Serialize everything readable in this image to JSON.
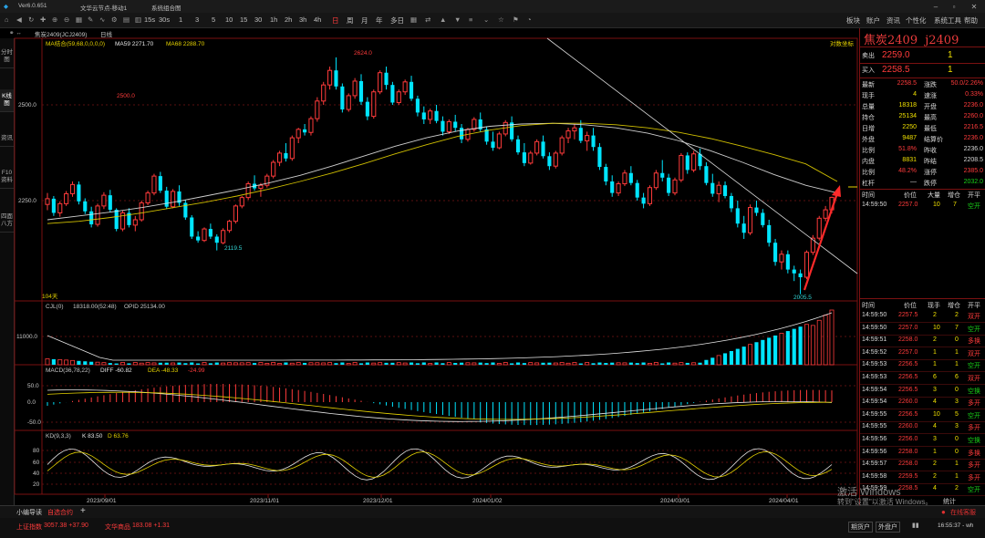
{
  "titlebar": {
    "app": "Ver6.0.651",
    "tabs": [
      "文华云节点-移动1",
      "系统组合图"
    ]
  },
  "toolbar": {
    "periods": [
      "1",
      "3",
      "5",
      "10",
      "15",
      "30",
      "1h",
      "2h",
      "3h",
      "4h",
      "日",
      "周",
      "月",
      "年",
      "多日"
    ],
    "right": [
      "板块",
      "账户",
      "资讯",
      "个性化",
      "系统工具",
      "帮助"
    ],
    "icon_names": [
      "home-icon",
      "back-icon",
      "refresh-icon",
      "cross-icon",
      "zoom-in-icon",
      "zoom-out-icon",
      "chart-icon",
      "draw-icon",
      "indicator-icon",
      "settings-icon",
      "layout-icon",
      "chevron-down-icon"
    ]
  },
  "subbar": {
    "contract": "焦炭2409(JCJ2409)",
    "period": "日线"
  },
  "left_tabs": [
    "分时图",
    "K线图",
    "资讯",
    "F10资料",
    "四面八方"
  ],
  "main": {
    "ma_line": "MA结合(59,68,0,0,0,0)",
    "ma59": "MA59 2271.70",
    "ma68": "MA68 2288.70",
    "log_label": "对数坐标",
    "y_labels": [
      "2500.0",
      "2250.0"
    ],
    "annotations": {
      "high": "2624.0",
      "mid": "2500.0",
      "low1": "2119.5",
      "low2": "2005.5",
      "days": "104天"
    }
  },
  "vol": {
    "label": "CJL(0)",
    "value": "18318.00(52:48)",
    "opi": "OPID 25134.00",
    "y_label": "11000.0"
  },
  "macd": {
    "label": "MACD(36,78,22)",
    "diff": "DIFF -60.82",
    "dea": "DEA -48.33",
    "val": "-24.99",
    "y_labels": [
      "50.0",
      "0.0",
      "-50.0"
    ]
  },
  "kd": {
    "label": "KD(9,3,3)",
    "k": "K 83.50",
    "d": "D 63.76",
    "y_labels": [
      "80",
      "60",
      "40",
      "20"
    ]
  },
  "x_labels": [
    "2023/09/01",
    "2023/11/01",
    "2023/12/01",
    "2024/01/02",
    "2024/03/01",
    "2024/04/01"
  ],
  "quote": {
    "name": "焦炭2409",
    "code": "j2409",
    "sell_label": "卖出",
    "sell_price": "2259.0",
    "sell_qty": "1",
    "buy_label": "买入",
    "buy_price": "2258.5",
    "buy_qty": "1",
    "rows": [
      [
        "最新",
        "2258.5",
        "涨跌",
        "50.0/2.26%"
      ],
      [
        "现手",
        "4",
        "速涨",
        "0.33%"
      ],
      [
        "总量",
        "18318",
        "开盘",
        "2236.0"
      ],
      [
        "持仓",
        "25134",
        "最高",
        "2260.0"
      ],
      [
        "日增",
        "2250",
        "最低",
        "2216.5"
      ],
      [
        "外盘",
        "9487",
        "结算价",
        "2236.0"
      ],
      [
        "比例",
        "51.8%",
        "昨收",
        "2236.0"
      ],
      [
        "内盘",
        "8831",
        "昨结",
        "2208.5"
      ],
      [
        "比例",
        "48.2%",
        "涨停",
        "2385.0"
      ],
      [
        "杠杆",
        "—",
        "跌停",
        "2032.0"
      ]
    ],
    "tick_header": [
      "时间",
      "价位",
      "现手",
      "增仓",
      "开平"
    ],
    "tick_header_top": [
      "时间",
      "价位",
      "大量",
      "增仓",
      "开平"
    ],
    "top_tick": [
      "14:59:50",
      "2257.0",
      "10",
      "7",
      "空开"
    ],
    "ticks": [
      [
        "14:59:50",
        "2257.5",
        "2",
        "2",
        "双开"
      ],
      [
        "14:59:50",
        "2257.0",
        "10",
        "7",
        "空开"
      ],
      [
        "14:59:51",
        "2258.0",
        "2",
        "0",
        "多换"
      ],
      [
        "14:59:52",
        "2257.0",
        "1",
        "1",
        "双开"
      ],
      [
        "14:59:53",
        "2256.5",
        "1",
        "1",
        "空开"
      ],
      [
        "14:59:53",
        "2256.5",
        "6",
        "6",
        "双开"
      ],
      [
        "14:59:54",
        "2256.5",
        "3",
        "0",
        "空换"
      ],
      [
        "14:59:54",
        "2260.0",
        "4",
        "3",
        "多开"
      ],
      [
        "14:59:55",
        "2256.5",
        "10",
        "5",
        "空开"
      ],
      [
        "14:59:55",
        "2260.0",
        "4",
        "3",
        "多开"
      ],
      [
        "14:59:56",
        "2256.0",
        "3",
        "0",
        "空换"
      ],
      [
        "14:59:56",
        "2258.0",
        "1",
        "0",
        "多换"
      ],
      [
        "14:59:57",
        "2258.0",
        "2",
        "1",
        "多开"
      ],
      [
        "14:59:58",
        "2259.5",
        "2",
        "1",
        "多开"
      ],
      [
        "14:59:59",
        "2258.5",
        "4",
        "2",
        "空开"
      ]
    ]
  },
  "bottom": {
    "tabs": [
      "小编导读",
      "自选合约"
    ],
    "add": "+",
    "right": "在线客服",
    "summary_label": "统计"
  },
  "status": {
    "index1": "上证指数",
    "index1_val": "3057.38 +37.90",
    "index2": "文华商品",
    "index2_val": "183.08 +1.31",
    "right": [
      "期货户",
      "外盘户"
    ],
    "time": "16:55:37 - wh"
  },
  "watermark": {
    "line1": "激活 Windows",
    "line2": "转到\"设置\"以激活 Windows。"
  },
  "colors": {
    "up": "#ff3b3b",
    "down": "#00e5ff",
    "ma59": "#e6e6e6",
    "ma68": "#e6d300",
    "frame": "#7a1111"
  },
  "chart_data": {
    "type": "candlestick",
    "title": "焦炭2409(JCJ2409) 日线",
    "ylabel": "",
    "ylim": [
      2000,
      2650
    ],
    "x_ticks": [
      "2023/09/01",
      "2023/11/01",
      "2023/12/01",
      "2024/01/02",
      "2024/03/01",
      "2024/04/01"
    ],
    "candles_ohlc": [
      [
        2240,
        2270,
        2225,
        2255
      ],
      [
        2255,
        2262,
        2210,
        2218
      ],
      [
        2218,
        2248,
        2208,
        2242
      ],
      [
        2242,
        2275,
        2236,
        2268
      ],
      [
        2268,
        2300,
        2260,
        2292
      ],
      [
        2292,
        2300,
        2240,
        2248
      ],
      [
        2248,
        2256,
        2215,
        2222
      ],
      [
        2222,
        2234,
        2180,
        2188
      ],
      [
        2188,
        2242,
        2182,
        2236
      ],
      [
        2236,
        2272,
        2228,
        2264
      ],
      [
        2264,
        2278,
        2220,
        2226
      ],
      [
        2226,
        2230,
        2170,
        2176
      ],
      [
        2176,
        2224,
        2170,
        2218
      ],
      [
        2218,
        2230,
        2180,
        2186
      ],
      [
        2186,
        2210,
        2170,
        2200
      ],
      [
        2200,
        2250,
        2195,
        2244
      ],
      [
        2244,
        2276,
        2238,
        2270
      ],
      [
        2270,
        2320,
        2264,
        2314
      ],
      [
        2314,
        2325,
        2270,
        2276
      ],
      [
        2276,
        2286,
        2228,
        2234
      ],
      [
        2234,
        2280,
        2230,
        2274
      ],
      [
        2274,
        2290,
        2236,
        2244
      ],
      [
        2244,
        2252,
        2200,
        2206
      ],
      [
        2206,
        2212,
        2150,
        2156
      ],
      [
        2156,
        2170,
        2140,
        2146
      ],
      [
        2146,
        2180,
        2142,
        2176
      ],
      [
        2176,
        2190,
        2150,
        2156
      ],
      [
        2156,
        2162,
        2120,
        2140
      ],
      [
        2140,
        2178,
        2136,
        2172
      ],
      [
        2172,
        2200,
        2166,
        2196
      ],
      [
        2196,
        2240,
        2190,
        2236
      ],
      [
        2236,
        2262,
        2230,
        2258
      ],
      [
        2258,
        2300,
        2252,
        2294
      ],
      [
        2294,
        2316,
        2276,
        2282
      ],
      [
        2282,
        2296,
        2260,
        2290
      ],
      [
        2290,
        2320,
        2284,
        2314
      ],
      [
        2314,
        2356,
        2308,
        2350
      ],
      [
        2350,
        2380,
        2340,
        2374
      ],
      [
        2374,
        2400,
        2352,
        2360
      ],
      [
        2360,
        2420,
        2354,
        2414
      ],
      [
        2414,
        2440,
        2400,
        2436
      ],
      [
        2436,
        2450,
        2420,
        2428
      ],
      [
        2428,
        2470,
        2420,
        2464
      ],
      [
        2464,
        2520,
        2456,
        2510
      ],
      [
        2510,
        2560,
        2500,
        2552
      ],
      [
        2552,
        2600,
        2540,
        2590
      ],
      [
        2590,
        2624,
        2540,
        2548
      ],
      [
        2548,
        2556,
        2480,
        2488
      ],
      [
        2488,
        2530,
        2482,
        2524
      ],
      [
        2524,
        2570,
        2516,
        2562
      ],
      [
        2562,
        2580,
        2500,
        2508
      ],
      [
        2508,
        2520,
        2460,
        2470
      ],
      [
        2470,
        2540,
        2464,
        2534
      ],
      [
        2534,
        2590,
        2528,
        2584
      ],
      [
        2584,
        2600,
        2540,
        2552
      ],
      [
        2552,
        2560,
        2500,
        2506
      ],
      [
        2506,
        2540,
        2500,
        2534
      ],
      [
        2534,
        2566,
        2526,
        2560
      ],
      [
        2560,
        2576,
        2510,
        2516
      ],
      [
        2516,
        2524,
        2470,
        2480
      ],
      [
        2480,
        2496,
        2450,
        2462
      ],
      [
        2462,
        2490,
        2450,
        2484
      ],
      [
        2484,
        2500,
        2452,
        2458
      ],
      [
        2458,
        2470,
        2420,
        2430
      ],
      [
        2430,
        2462,
        2424,
        2456
      ],
      [
        2456,
        2474,
        2430,
        2440
      ],
      [
        2440,
        2450,
        2400,
        2410
      ],
      [
        2410,
        2440,
        2404,
        2436
      ],
      [
        2436,
        2468,
        2430,
        2462
      ],
      [
        2462,
        2480,
        2430,
        2436
      ],
      [
        2436,
        2444,
        2396,
        2404
      ],
      [
        2404,
        2430,
        2380,
        2388
      ],
      [
        2388,
        2430,
        2384,
        2424
      ],
      [
        2424,
        2460,
        2418,
        2454
      ],
      [
        2454,
        2470,
        2404,
        2410
      ],
      [
        2410,
        2420,
        2370,
        2376
      ],
      [
        2376,
        2400,
        2340,
        2348
      ],
      [
        2348,
        2380,
        2344,
        2374
      ],
      [
        2374,
        2410,
        2368,
        2404
      ],
      [
        2404,
        2420,
        2360,
        2366
      ],
      [
        2366,
        2376,
        2330,
        2340
      ],
      [
        2340,
        2380,
        2334,
        2374
      ],
      [
        2374,
        2420,
        2368,
        2414
      ],
      [
        2414,
        2440,
        2400,
        2432
      ],
      [
        2432,
        2450,
        2410,
        2440
      ],
      [
        2440,
        2460,
        2400,
        2406
      ],
      [
        2406,
        2430,
        2380,
        2420
      ],
      [
        2420,
        2440,
        2380,
        2390
      ],
      [
        2390,
        2400,
        2330,
        2338
      ],
      [
        2338,
        2346,
        2290,
        2300
      ],
      [
        2300,
        2316,
        2260,
        2270
      ],
      [
        2270,
        2300,
        2262,
        2294
      ],
      [
        2294,
        2330,
        2288,
        2322
      ],
      [
        2322,
        2340,
        2290,
        2296
      ],
      [
        2296,
        2304,
        2250,
        2258
      ],
      [
        2258,
        2270,
        2230,
        2242
      ],
      [
        2242,
        2290,
        2236,
        2284
      ],
      [
        2284,
        2330,
        2278,
        2322
      ],
      [
        2322,
        2356,
        2300,
        2310
      ],
      [
        2310,
        2320,
        2262,
        2270
      ],
      [
        2270,
        2310,
        2264,
        2304
      ],
      [
        2304,
        2374,
        2298,
        2368
      ],
      [
        2368,
        2376,
        2320,
        2330
      ],
      [
        2330,
        2380,
        2324,
        2372
      ],
      [
        2372,
        2386,
        2330,
        2340
      ],
      [
        2340,
        2350,
        2290,
        2296
      ],
      [
        2296,
        2320,
        2260,
        2268
      ],
      [
        2268,
        2300,
        2246,
        2290
      ],
      [
        2290,
        2300,
        2256,
        2262
      ],
      [
        2262,
        2270,
        2220,
        2230
      ],
      [
        2230,
        2250,
        2180,
        2190
      ],
      [
        2190,
        2210,
        2150,
        2166
      ],
      [
        2166,
        2240,
        2160,
        2232
      ],
      [
        2232,
        2250,
        2210,
        2218
      ],
      [
        2218,
        2228,
        2180,
        2186
      ],
      [
        2186,
        2200,
        2130,
        2140
      ],
      [
        2140,
        2150,
        2080,
        2090
      ],
      [
        2090,
        2120,
        2070,
        2110
      ],
      [
        2110,
        2120,
        2060,
        2070
      ],
      [
        2070,
        2080,
        2040,
        2060
      ],
      [
        2060,
        2070,
        2005.5,
        2050
      ],
      [
        2050,
        2120,
        2045,
        2115
      ],
      [
        2115,
        2160,
        2108,
        2152
      ],
      [
        2152,
        2210,
        2146,
        2204
      ],
      [
        2204,
        2236,
        2196,
        2226
      ],
      [
        2226,
        2260,
        2216.5,
        2258.5
      ]
    ],
    "series": [
      {
        "name": "MA59",
        "values": [
          2200,
          2210,
          2220,
          2232,
          2246,
          2262,
          2278,
          2296,
          2316,
          2340,
          2366,
          2392,
          2414,
          2432,
          2444,
          2450,
          2452,
          2448,
          2440,
          2426,
          2406,
          2380,
          2350,
          2318,
          2290,
          2270
        ]
      },
      {
        "name": "MA68",
        "values": [
          2190,
          2196,
          2206,
          2218,
          2232,
          2246,
          2262,
          2280,
          2300,
          2322,
          2346,
          2372,
          2396,
          2418,
          2434,
          2446,
          2452,
          2452,
          2448,
          2440,
          2428,
          2412,
          2392,
          2370,
          2346,
          2300
        ]
      }
    ],
    "grid": false
  }
}
